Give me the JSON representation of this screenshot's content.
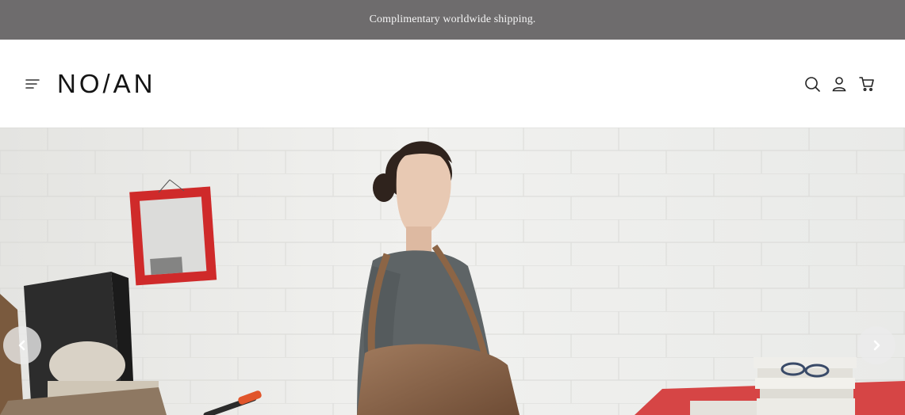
{
  "announcement": {
    "text": "Complimentary worldwide shipping."
  },
  "header": {
    "logo_text": "NO/AN",
    "menu_icon": "menu-icon",
    "actions": [
      {
        "name": "search",
        "icon": "search-icon"
      },
      {
        "name": "account",
        "icon": "user-icon"
      },
      {
        "name": "cart",
        "icon": "cart-icon"
      }
    ]
  },
  "hero": {
    "image": "model-with-brown-leather-tote-in-studio",
    "prev_icon": "chevron-left-icon",
    "next_icon": "chevron-right-icon"
  },
  "colors": {
    "announcement_bg": "#6e6c6d",
    "announcement_text": "#f4f4f4",
    "logo": "#141414",
    "arrow_bg": "#ebebeb"
  }
}
